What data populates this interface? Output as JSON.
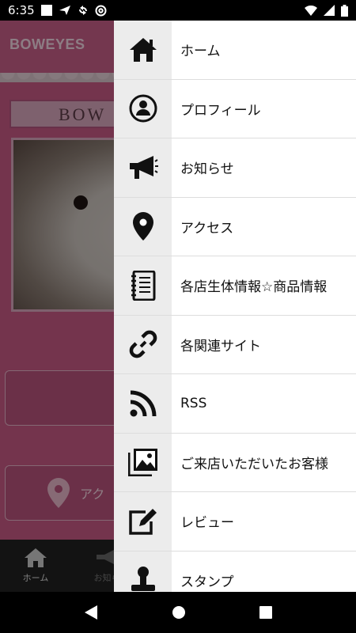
{
  "status_bar": {
    "time": "6:35"
  },
  "app": {
    "title": "BOWEYES",
    "brand_plate": "BOW",
    "access_button_label": "アク"
  },
  "tab_bar": {
    "tabs": [
      {
        "label": "ホーム",
        "icon": "home-icon"
      },
      {
        "label": "お知ら",
        "icon": "megaphone-icon"
      }
    ]
  },
  "drawer": {
    "items": [
      {
        "label": "ホーム",
        "icon": "home-icon"
      },
      {
        "label": "プロフィール",
        "icon": "profile-icon"
      },
      {
        "label": "お知らせ",
        "icon": "megaphone-icon"
      },
      {
        "label": "アクセス",
        "icon": "location-pin-icon"
      },
      {
        "label": "各店生体情報☆商品情報",
        "icon": "notebook-icon"
      },
      {
        "label": "各関連サイト",
        "icon": "link-icon"
      },
      {
        "label": "RSS",
        "icon": "rss-icon"
      },
      {
        "label": "ご来店いただいたお客様",
        "icon": "photo-gallery-icon"
      },
      {
        "label": "レビュー",
        "icon": "review-edit-icon"
      },
      {
        "label": "スタンプ",
        "icon": "stamp-icon"
      }
    ]
  }
}
